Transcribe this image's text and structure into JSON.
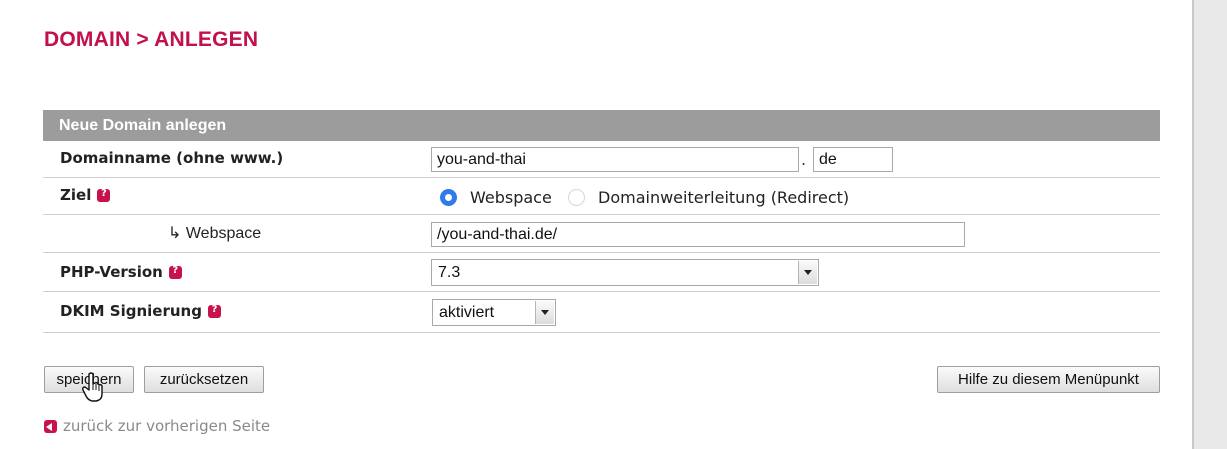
{
  "page": {
    "title": "DOMAIN > ANLEGEN"
  },
  "colors": {
    "accent": "#c2104a",
    "header_bg": "#9c9c9c",
    "radio_selected": "#2f7bea"
  },
  "form": {
    "header": "Neue Domain anlegen",
    "domainname": {
      "label": "Domainname (ohne www.)",
      "value": "you-and-thai",
      "separator": ".",
      "tld_value": "de"
    },
    "ziel": {
      "label": "Ziel",
      "help_icon": "help-icon",
      "options": [
        {
          "label": "Webspace",
          "selected": true
        },
        {
          "label": "Domainweiterleitung (Redirect)",
          "selected": false
        }
      ]
    },
    "webspace": {
      "label": "↳ Webspace",
      "value": "/you-and-thai.de/"
    },
    "php_version": {
      "label": "PHP-Version",
      "help_icon": "help-icon",
      "selected": "7.3"
    },
    "dkim": {
      "label": "DKIM Signierung",
      "help_icon": "help-icon",
      "selected": "aktiviert"
    }
  },
  "buttons": {
    "save": "speichern",
    "reset": "zurücksetzen",
    "help": "Hilfe zu diesem Menüpunkt"
  },
  "back_link": {
    "icon": "back-arrow-icon",
    "label": "zurück zur vorherigen Seite"
  },
  "cursor": {
    "icon": "hand-pointer-icon"
  }
}
